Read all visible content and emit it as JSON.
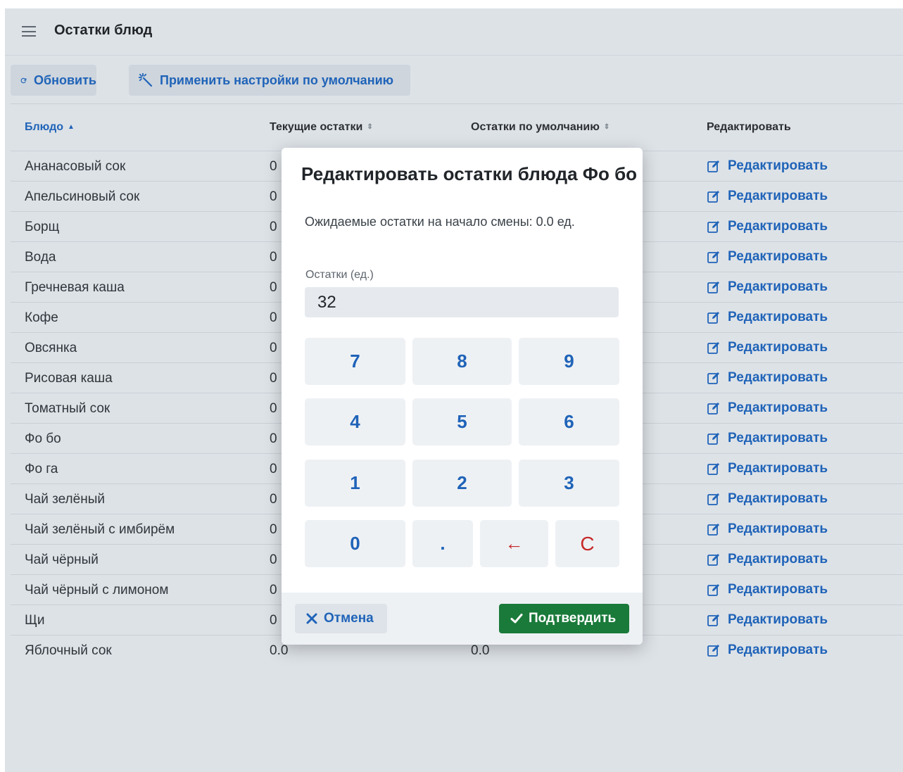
{
  "header": {
    "title": "Остатки блюд"
  },
  "toolbar": {
    "refresh_label": "Обновить",
    "defaults_label": "Применить настройки по умолчанию"
  },
  "table": {
    "columns": {
      "dish": "Блюдо",
      "current": "Текущие остатки",
      "default": "Остатки по умолчанию",
      "edit": "Редактировать"
    },
    "rows": [
      {
        "dish": "Ананасовый сок",
        "current": "0",
        "default": "",
        "edit": "Редактировать"
      },
      {
        "dish": "Апельсиновый сок",
        "current": "0",
        "default": "",
        "edit": "Редактировать"
      },
      {
        "dish": "Борщ",
        "current": "0",
        "default": "",
        "edit": "Редактировать"
      },
      {
        "dish": "Вода",
        "current": "0",
        "default": "",
        "edit": "Редактировать"
      },
      {
        "dish": "Гречневая каша",
        "current": "0",
        "default": "",
        "edit": "Редактировать"
      },
      {
        "dish": "Кофе",
        "current": "0",
        "default": "",
        "edit": "Редактировать"
      },
      {
        "dish": "Овсянка",
        "current": "0",
        "default": "",
        "edit": "Редактировать"
      },
      {
        "dish": "Рисовая каша",
        "current": "0",
        "default": "",
        "edit": "Редактировать"
      },
      {
        "dish": "Томатный сок",
        "current": "0",
        "default": "",
        "edit": "Редактировать"
      },
      {
        "dish": "Фо бо",
        "current": "0",
        "default": "",
        "edit": "Редактировать"
      },
      {
        "dish": "Фо га",
        "current": "0",
        "default": "",
        "edit": "Редактировать"
      },
      {
        "dish": "Чай зелёный",
        "current": "0",
        "default": "",
        "edit": "Редактировать"
      },
      {
        "dish": "Чай зелёный с имбирём",
        "current": "0",
        "default": "",
        "edit": "Редактировать"
      },
      {
        "dish": "Чай чёрный",
        "current": "0",
        "default": "",
        "edit": "Редактировать"
      },
      {
        "dish": "Чай чёрный с лимоном",
        "current": "0",
        "default": "",
        "edit": "Редактировать"
      },
      {
        "dish": "Щи",
        "current": "0",
        "default": "",
        "edit": "Редактировать"
      },
      {
        "dish": "Яблочный сок",
        "current": "0.0",
        "default": "0.0",
        "edit": "Редактировать"
      }
    ]
  },
  "modal": {
    "title": "Редактировать остатки блюда Фо бо",
    "subtitle": "Ожидаемые остатки на начало смены: 0.0 ед.",
    "field_label": "Остатки (ед.)",
    "field_value": "32",
    "keys": {
      "k7": "7",
      "k8": "8",
      "k9": "9",
      "k4": "4",
      "k5": "5",
      "k6": "6",
      "k1": "1",
      "k2": "2",
      "k3": "3",
      "k0": "0",
      "dot": ".",
      "back": "←",
      "clear": "C"
    },
    "cancel_label": "Отмена",
    "confirm_label": "Подтвердить"
  },
  "colors": {
    "accent": "#1f63b8",
    "confirm": "#1a7a3a",
    "danger": "#c62828",
    "background": "#dde2e7"
  },
  "icons": {
    "menu": "hamburger-icon",
    "refresh": "refresh-icon",
    "defaults": "magic-wand-icon",
    "edit": "edit-icon",
    "cancel": "close-icon",
    "confirm": "check-icon"
  }
}
